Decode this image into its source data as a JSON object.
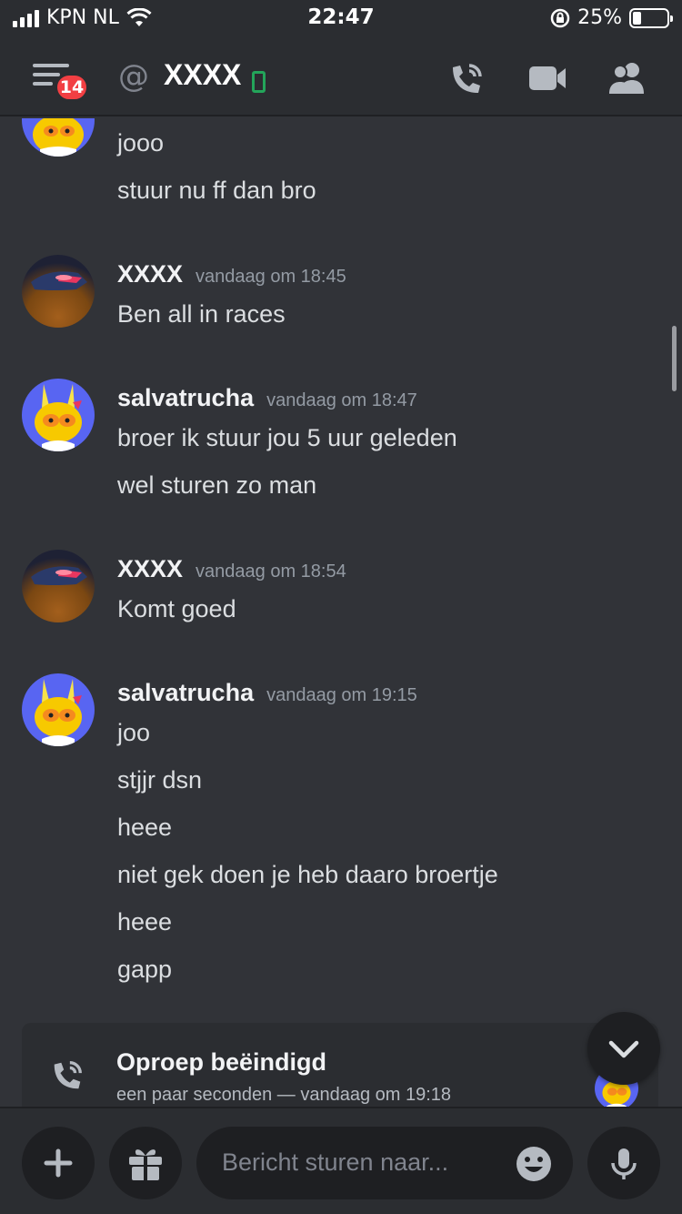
{
  "status_bar": {
    "carrier": "KPN NL",
    "time": "22:47",
    "battery": "25%",
    "battery_fraction": 0.25
  },
  "header": {
    "unread_badge": "14",
    "channel_name": "XXXX"
  },
  "messages": [
    {
      "lines": [
        "jooo",
        "stuur nu ff dan bro"
      ]
    },
    {
      "author": "XXXX",
      "timestamp": "vandaag om 18:45",
      "lines": [
        "Ben all in races"
      ]
    },
    {
      "author": "salvatrucha",
      "timestamp": "vandaag om 18:47",
      "lines": [
        "broer ik stuur jou 5 uur geleden",
        "wel sturen zo man"
      ]
    },
    {
      "author": "XXXX",
      "timestamp": "vandaag om 18:54",
      "lines": [
        "Komt goed"
      ]
    },
    {
      "author": "salvatrucha",
      "timestamp": "vandaag om 19:15",
      "lines": [
        "joo",
        "stjjr dsn",
        "heee",
        "niet gek doen je heb daaro broertje",
        "heee",
        "gapp"
      ]
    }
  ],
  "call": {
    "title": "Oproep beëindigd",
    "subtitle": "een paar seconden — vandaag om 19:18"
  },
  "composer": {
    "placeholder": "Bericht sturen naar..."
  },
  "colors": {
    "background": "#313338",
    "header": "#2b2d31",
    "badge": "#f23f43",
    "online_mobile": "#23a55a",
    "avatar_blurple": "#5865f2"
  },
  "icons": [
    "menu-icon",
    "at-icon",
    "mobile-status-icon",
    "voice-call-icon",
    "video-call-icon",
    "members-icon",
    "phone-call-icon",
    "chevron-down-icon",
    "plus-icon",
    "gift-icon",
    "emoji-icon",
    "microphone-icon",
    "wifi-icon",
    "rotation-lock-icon"
  ]
}
